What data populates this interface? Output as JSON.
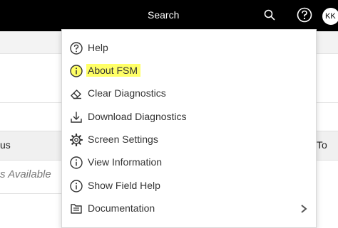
{
  "header": {
    "search_label": "Search",
    "avatar_initials": "KK"
  },
  "background": {
    "column_left": "us",
    "column_right": "To",
    "empty_text": "s Available"
  },
  "menu": {
    "items": [
      {
        "label": "Help",
        "icon": "help-circle-icon"
      },
      {
        "label": "About FSM",
        "icon": "info-icon",
        "highlight_color": "#ffff66"
      },
      {
        "label": "Clear Diagnostics",
        "icon": "eraser-icon"
      },
      {
        "label": "Download Diagnostics",
        "icon": "download-icon"
      },
      {
        "label": "Screen Settings",
        "icon": "gear-icon"
      },
      {
        "label": "View Information",
        "icon": "info-icon"
      },
      {
        "label": "Show Field Help",
        "icon": "info-icon"
      },
      {
        "label": "Documentation",
        "icon": "book-icon"
      }
    ]
  }
}
